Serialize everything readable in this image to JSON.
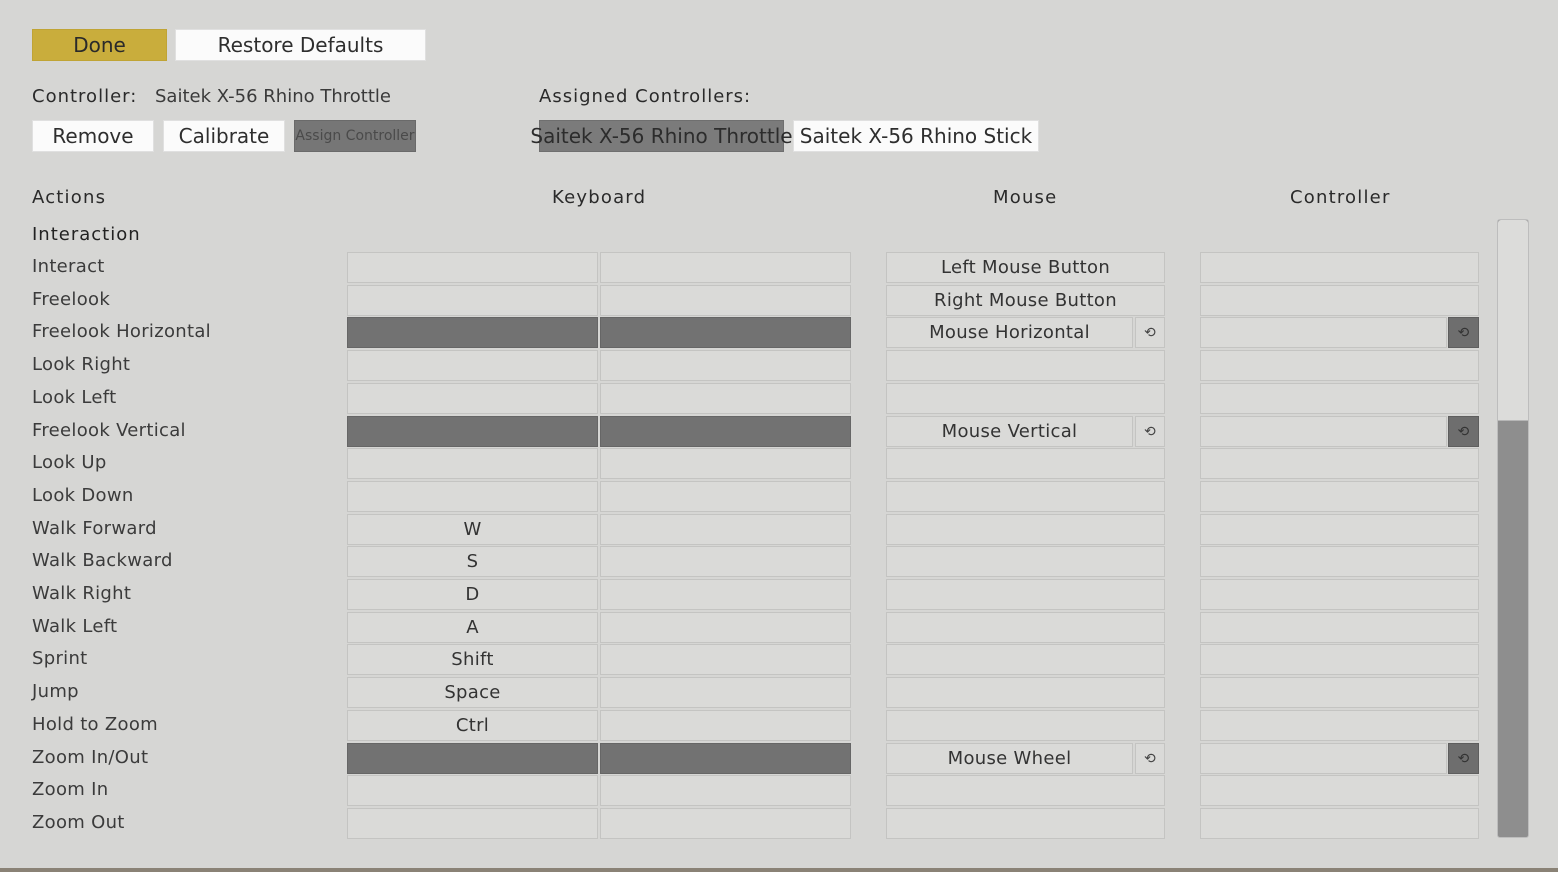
{
  "toolbar": {
    "done_label": "Done",
    "restore_label": "Restore Defaults"
  },
  "controller": {
    "label": "Controller:",
    "name": "Saitek X-56 Rhino Throttle",
    "remove_label": "Remove",
    "calibrate_label": "Calibrate",
    "assign_label": "Assign Controller"
  },
  "assigned": {
    "label": "Assigned Controllers:",
    "items": [
      "Saitek X-56 Rhino Throttle",
      "Saitek X-56 Rhino Stick"
    ],
    "selected_index": 0
  },
  "columns": {
    "actions": "Actions",
    "keyboard": "Keyboard",
    "mouse": "Mouse",
    "controller": "Controller"
  },
  "section": "Interaction",
  "reset_icon": "⟲",
  "rows": [
    {
      "action": "Interact",
      "key1": "",
      "key2": "",
      "mouse": "Left Mouse Button",
      "axis": false
    },
    {
      "action": "Freelook",
      "key1": "",
      "key2": "",
      "mouse": "Right Mouse Button",
      "axis": false
    },
    {
      "action": "Freelook Horizontal",
      "key1": "",
      "key2": "",
      "mouse": "Mouse Horizontal",
      "axis": true
    },
    {
      "action": "Look Right",
      "key1": "",
      "key2": "",
      "mouse": "",
      "axis": false
    },
    {
      "action": "Look Left",
      "key1": "",
      "key2": "",
      "mouse": "",
      "axis": false
    },
    {
      "action": "Freelook Vertical",
      "key1": "",
      "key2": "",
      "mouse": "Mouse Vertical",
      "axis": true
    },
    {
      "action": "Look Up",
      "key1": "",
      "key2": "",
      "mouse": "",
      "axis": false
    },
    {
      "action": "Look Down",
      "key1": "",
      "key2": "",
      "mouse": "",
      "axis": false
    },
    {
      "action": "Walk Forward",
      "key1": "W",
      "key2": "",
      "mouse": "",
      "axis": false
    },
    {
      "action": "Walk Backward",
      "key1": "S",
      "key2": "",
      "mouse": "",
      "axis": false
    },
    {
      "action": "Walk Right",
      "key1": "D",
      "key2": "",
      "mouse": "",
      "axis": false
    },
    {
      "action": "Walk Left",
      "key1": "A",
      "key2": "",
      "mouse": "",
      "axis": false
    },
    {
      "action": "Sprint",
      "key1": "Shift",
      "key2": "",
      "mouse": "",
      "axis": false
    },
    {
      "action": "Jump",
      "key1": "Space",
      "key2": "",
      "mouse": "",
      "axis": false
    },
    {
      "action": "Hold to Zoom",
      "key1": "Ctrl",
      "key2": "",
      "mouse": "",
      "axis": false
    },
    {
      "action": "Zoom In/Out",
      "key1": "",
      "key2": "",
      "mouse": "Mouse Wheel",
      "axis": true
    },
    {
      "action": "Zoom In",
      "key1": "",
      "key2": "",
      "mouse": "",
      "axis": false
    },
    {
      "action": "Zoom Out",
      "key1": "",
      "key2": "",
      "mouse": "",
      "axis": false
    }
  ],
  "scroll_fraction_visible": 0.32
}
